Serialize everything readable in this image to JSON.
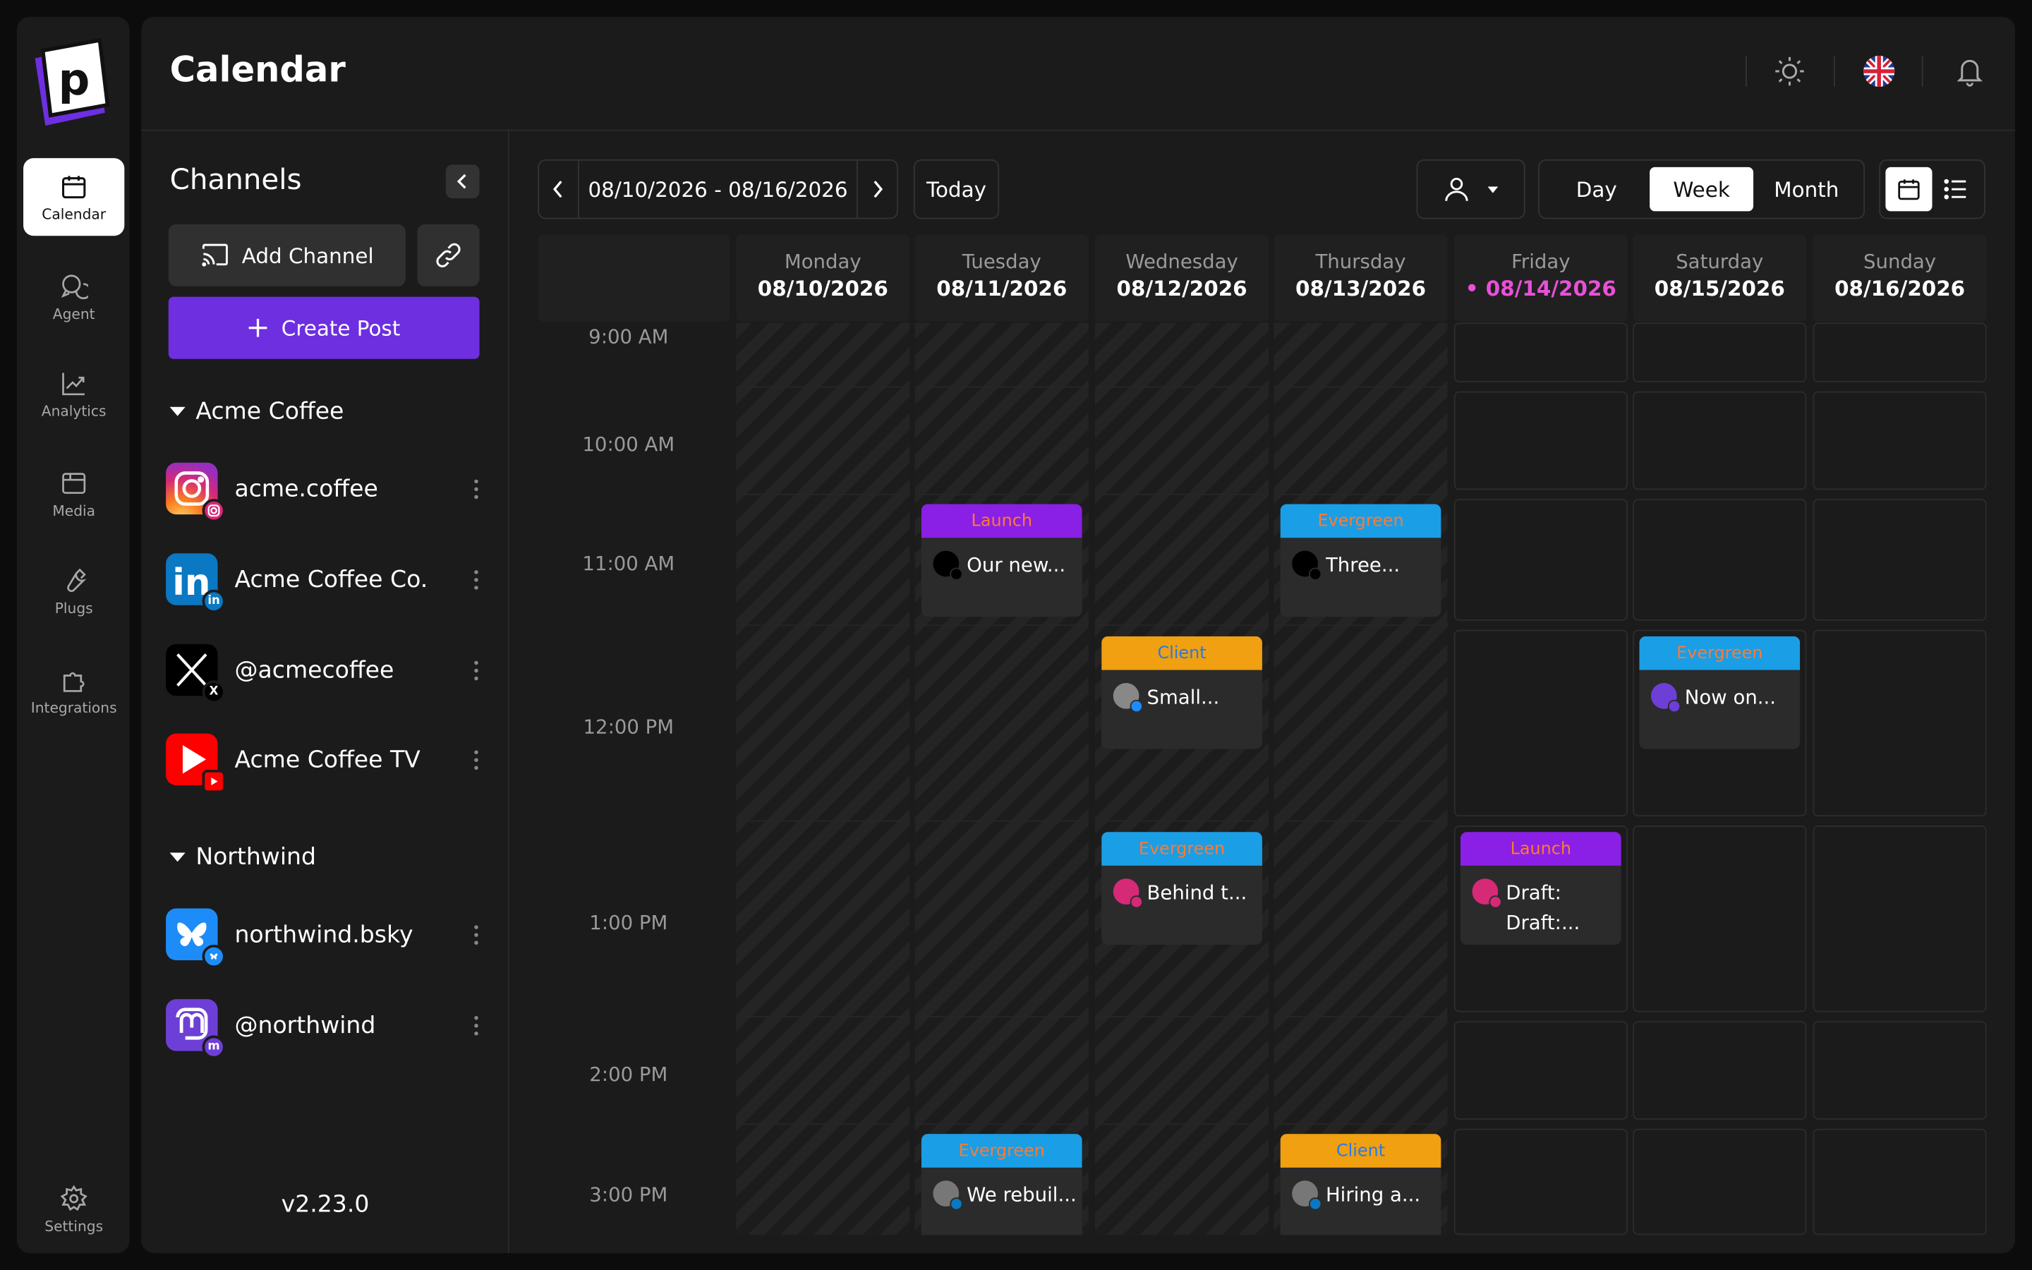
{
  "nav": {
    "items": [
      {
        "label": "Calendar",
        "icon": "calendar-icon",
        "active": true
      },
      {
        "label": "Agent",
        "icon": "chat-icon"
      },
      {
        "label": "Analytics",
        "icon": "chart-icon"
      },
      {
        "label": "Media",
        "icon": "media-icon"
      },
      {
        "label": "Plugs",
        "icon": "wrench-icon"
      },
      {
        "label": "Integrations",
        "icon": "puzzle-icon"
      }
    ],
    "settings_label": "Settings"
  },
  "header": {
    "title": "Calendar"
  },
  "channels": {
    "title": "Channels",
    "add_channel_label": "Add Channel",
    "create_post_label": "Create Post",
    "groups": [
      {
        "name": "Acme Coffee",
        "items": [
          {
            "name": "acme.coffee",
            "platform": "instagram"
          },
          {
            "name": "Acme Coffee Co.",
            "platform": "linkedin"
          },
          {
            "name": "@acmecoffee",
            "platform": "x"
          },
          {
            "name": "Acme Coffee TV",
            "platform": "youtube"
          }
        ]
      },
      {
        "name": "Northwind",
        "items": [
          {
            "name": "northwind.bsky",
            "platform": "bluesky"
          },
          {
            "name": "@northwind",
            "platform": "mastodon"
          }
        ]
      }
    ],
    "version": "v2.23.0"
  },
  "toolbar": {
    "date_range": "08/10/2026 - 08/16/2026",
    "today_label": "Today",
    "views": [
      "Day",
      "Week",
      "Month"
    ],
    "active_view": "Week"
  },
  "calendar": {
    "days": [
      {
        "name": "Monday",
        "date": "08/10/2026"
      },
      {
        "name": "Tuesday",
        "date": "08/11/2026"
      },
      {
        "name": "Wednesday",
        "date": "08/12/2026"
      },
      {
        "name": "Thursday",
        "date": "08/13/2026"
      },
      {
        "name": "Friday",
        "date": "• 08/14/2026",
        "today": true
      },
      {
        "name": "Saturday",
        "date": "08/15/2026"
      },
      {
        "name": "Sunday",
        "date": "08/16/2026"
      }
    ],
    "times": [
      "9:00 AM",
      "10:00 AM",
      "11:00 AM",
      "12:00 PM",
      "1:00 PM",
      "2:00 PM",
      "3:00 PM"
    ],
    "events": [
      {
        "day": 1,
        "hour": 2,
        "tag": "Launch",
        "tag_color": "#8a1fe6",
        "tag_text_color": "#ff7a30",
        "platform": "x",
        "text": "Our new..."
      },
      {
        "day": 3,
        "hour": 2,
        "tag": "Evergreen",
        "tag_color": "#1a9ee6",
        "tag_text_color": "#ff7a30",
        "platform": "x",
        "text": "Three..."
      },
      {
        "day": 2,
        "hour": 3,
        "tag": "Client",
        "tag_color": "#f0a010",
        "tag_text_color": "#2a7ae6",
        "platform": "bluesky",
        "text": "Small..."
      },
      {
        "day": 5,
        "hour": 3,
        "tag": "Evergreen",
        "tag_color": "#1a9ee6",
        "tag_text_color": "#ff7a30",
        "platform": "mastodon",
        "text": "Now on..."
      },
      {
        "day": 2,
        "hour": 4,
        "tag": "Evergreen",
        "tag_color": "#1a9ee6",
        "tag_text_color": "#ff7a30",
        "platform": "instagram",
        "text": "Behind t..."
      },
      {
        "day": 4,
        "hour": 4,
        "tag": "Launch",
        "tag_color": "#8a1fe6",
        "tag_text_color": "#ff7a30",
        "platform": "instagram",
        "text": "Draft:",
        "text2": "Draft:..."
      },
      {
        "day": 1,
        "hour": 6,
        "tag": "Evergreen",
        "tag_color": "#1a9ee6",
        "tag_text_color": "#ff7a30",
        "platform": "linkedin",
        "text": "We rebuil..."
      },
      {
        "day": 3,
        "hour": 6,
        "tag": "Client",
        "tag_color": "#f0a010",
        "tag_text_color": "#2a7ae6",
        "platform": "linkedin",
        "text": "Hiring a..."
      }
    ]
  },
  "colors": {
    "accent": "#6d2fe0",
    "today": "#e850d8",
    "background": "#1b1b1b"
  }
}
